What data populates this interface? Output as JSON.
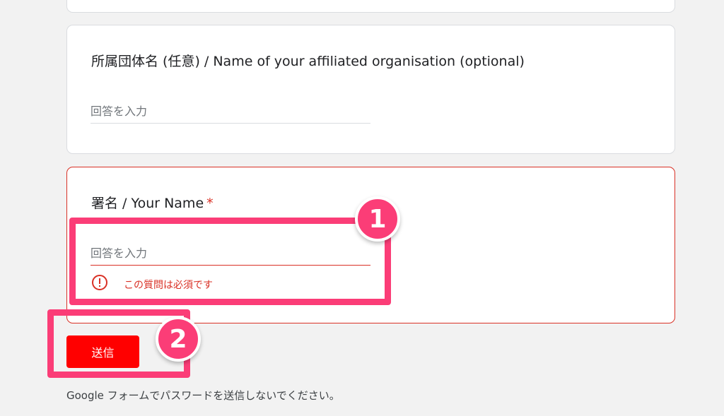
{
  "form": {
    "questions": [
      {
        "title": "所属団体名 (任意) / Name of your affiliated organisation (optional)",
        "placeholder": "回答を入力",
        "required": false
      },
      {
        "title": "署名 / Your Name",
        "required_marker": "*",
        "placeholder": "回答を入力",
        "required": true,
        "error": "この質問は必須です"
      }
    ],
    "submit_label": "送信",
    "footer_note": "Google フォームでパスワードを送信しないでください。"
  },
  "annotations": {
    "badge_1": "1",
    "badge_2": "2"
  },
  "colors": {
    "error": "#d93025",
    "submit": "#ff0000",
    "highlight": "#fb3d77"
  }
}
